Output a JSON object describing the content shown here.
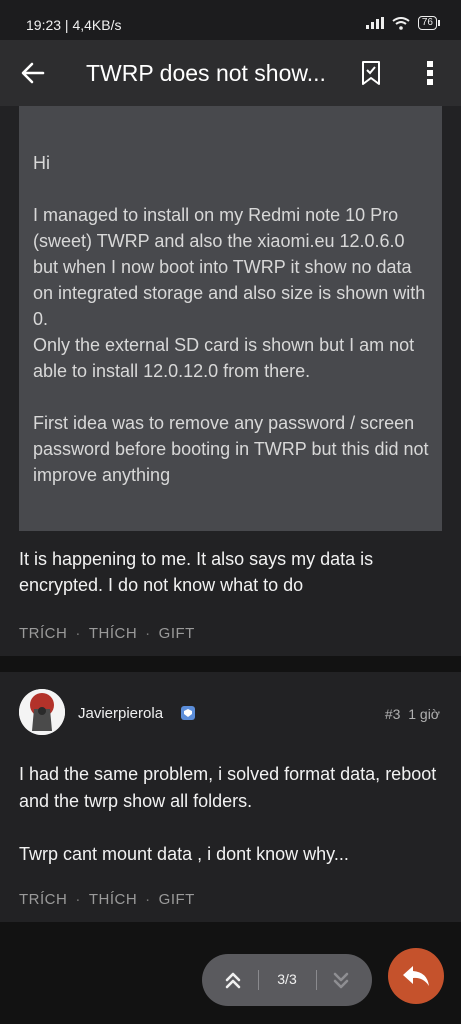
{
  "status_bar": {
    "time_speed": "19:23 | 4,4KB/s",
    "battery": "76"
  },
  "app_bar": {
    "title": "TWRP does not show..."
  },
  "post1": {
    "quote_paragraphs": [
      "Hi",
      "I managed to install on my Redmi note 10 Pro (sweet) TWRP and also the xiaomi.eu 12.0.6.0 but when I now boot into TWRP it show no data on integrated storage and also size is shown with 0.",
      "Only the external SD card is shown but I am not able to install 12.0.12.0 from there.",
      "First idea was to remove any password / screen password before booting in TWRP but this did not improve anything"
    ],
    "reply": "It is happening to me. It also says my data is encrypted. I do not know what to do",
    "actions": {
      "quote": "TRÍCH",
      "like": "THÍCH",
      "gift": "GIFT",
      "separator": "·"
    }
  },
  "post2": {
    "username": "Javierpierola",
    "post_number": "#3",
    "time_ago": "1 giờ",
    "paragraphs": [
      "I had the same problem, i solved format data, reboot and the twrp show all folders.",
      "Twrp cant mount data , i dont know why..."
    ],
    "actions": {
      "quote": "TRÍCH",
      "like": "THÍCH",
      "gift": "GIFT",
      "separator": "·"
    }
  },
  "pager": {
    "count": "3/3"
  },
  "colors": {
    "accent": "#c5522c",
    "badge": "#5b8dd9"
  }
}
